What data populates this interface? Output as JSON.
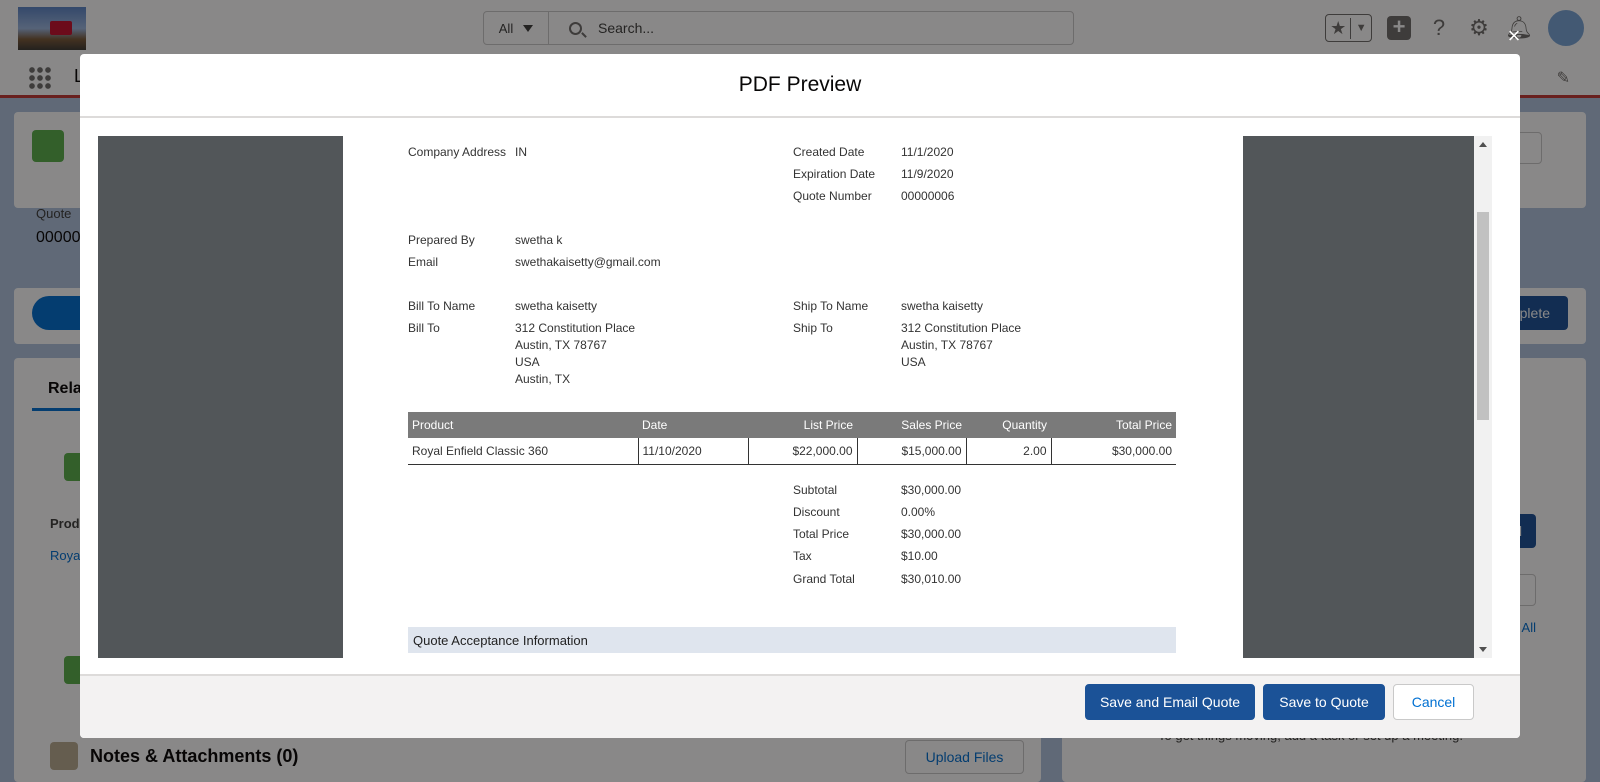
{
  "header": {
    "search_scope": "All",
    "search_placeholder": "Search...",
    "nav_letter": "L"
  },
  "background": {
    "quote_label": "Quote",
    "quote_value": "00000",
    "related_tab": "Rela",
    "products_col": "Prod",
    "product_link": "Roya",
    "complete_btn": "plete",
    "add_btn": "d",
    "view_all": "View All",
    "notes_title": "Notes & Attachments (0)",
    "upload_btn": "Upload Files",
    "activity_hint": "To get things moving, add a task or set up a meeting."
  },
  "modal": {
    "title": "PDF Preview",
    "close_label": "×"
  },
  "pdf": {
    "company_address_label": "Company Address",
    "company_address_value": "IN",
    "created_date_label": "Created Date",
    "created_date_value": "11/1/2020",
    "expiration_date_label": "Expiration Date",
    "expiration_date_value": "11/9/2020",
    "quote_number_label": "Quote Number",
    "quote_number_value": "00000006",
    "prepared_by_label": "Prepared By",
    "prepared_by_value": "swetha k",
    "email_label": "Email",
    "email_value": "swethakaisetty@gmail.com",
    "bill_to_name_label": "Bill To Name",
    "bill_to_name_value": "swetha kaisetty",
    "ship_to_name_label": "Ship To Name",
    "ship_to_name_value": "swetha kaisetty",
    "bill_to_label": "Bill To",
    "bill_to_lines": [
      "312 Constitution Place",
      "Austin, TX 78767",
      "USA",
      "Austin, TX"
    ],
    "ship_to_label": "Ship To",
    "ship_to_lines": [
      "312 Constitution Place",
      "Austin, TX 78767",
      "USA"
    ],
    "table_headers": [
      "Product",
      "Date",
      "List Price",
      "Sales Price",
      "Quantity",
      "Total Price"
    ],
    "table_rows": [
      [
        "Royal Enfield Classic 360",
        "11/10/2020",
        "$22,000.00",
        "$15,000.00",
        "2.00",
        "$30,000.00"
      ]
    ],
    "subtotal_label": "Subtotal",
    "subtotal_value": "$30,000.00",
    "discount_label": "Discount",
    "discount_value": "0.00%",
    "total_price_label": "Total Price",
    "total_price_value": "$30,000.00",
    "tax_label": "Tax",
    "tax_value": "$10.00",
    "grand_total_label": "Grand Total",
    "grand_total_value": "$30,010.00",
    "acceptance_section": "Quote Acceptance Information"
  },
  "footer": {
    "save_email_label": "Save and Email Quote",
    "save_label": "Save to Quote",
    "cancel_label": "Cancel"
  }
}
